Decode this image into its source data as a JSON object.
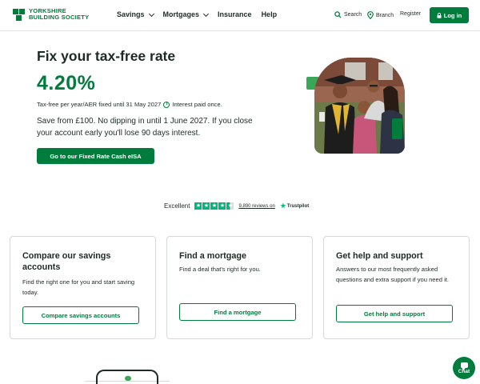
{
  "header": {
    "logo_line1": "YORKSHIRE",
    "logo_line2": "BUILDING SOCIETY",
    "nav": [
      {
        "label": "Savings",
        "has_dropdown": true
      },
      {
        "label": "Mortgages",
        "has_dropdown": true
      },
      {
        "label": "Insurance",
        "has_dropdown": false
      },
      {
        "label": "Help",
        "has_dropdown": false
      }
    ],
    "search_label": "Search",
    "branch_label": "Branch",
    "register_label": "Register",
    "login_label": "Log in"
  },
  "hero": {
    "title": "Fix your tax-free rate",
    "rate": "4.20%",
    "rate_note": "Tax-free per year/AER fixed until 31 May 2027",
    "interest_note": "Interest paid once.",
    "description": "Save from £100. No dipping in until 1 June 2027. If you close your account early you'll lose 90 days interest.",
    "cta_label": "Go to our Fixed Rate Cash eISA"
  },
  "trustpilot": {
    "rating_word": "Excellent",
    "stars": 4.5,
    "reviews": "9,890 reviews on",
    "brand": "Trustpilot"
  },
  "cards": [
    {
      "title": "Compare our savings accounts",
      "text": "Find the right one for you and start saving today.",
      "button": "Compare savings accounts"
    },
    {
      "title": "Find a mortgage",
      "text": "Find a deal that's right for you.",
      "button": "Find a mortgage"
    },
    {
      "title": "Get help and support",
      "text": "Answers to our most frequently asked questions and extra support if you need it.",
      "button": "Get help and support"
    }
  ],
  "chat_label": "Chat",
  "colors": {
    "brand_green": "#007c3d",
    "accent_green": "#3aa657",
    "trustpilot_green": "#00b67a",
    "text": "#1e2b24"
  }
}
